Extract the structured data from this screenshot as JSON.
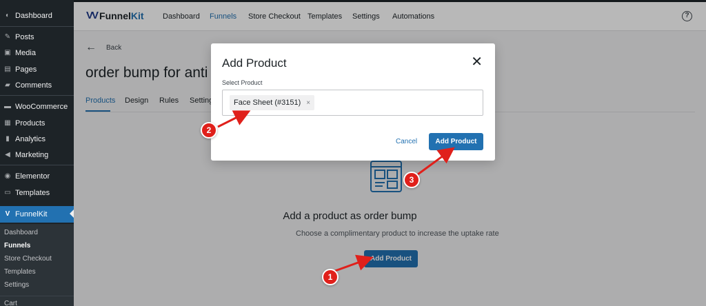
{
  "colors": {
    "accent": "#2271b1",
    "sidebar_bg": "#1d2327",
    "annotation": "#e0201b"
  },
  "sidebar": {
    "items": [
      {
        "label": "Dashboard",
        "icon": "dashboard-icon"
      },
      {
        "label": "Posts",
        "icon": "pin-icon"
      },
      {
        "label": "Media",
        "icon": "media-icon"
      },
      {
        "label": "Pages",
        "icon": "pages-icon"
      },
      {
        "label": "Comments",
        "icon": "comment-icon"
      },
      {
        "label": "WooCommerce",
        "icon": "woocommerce-icon"
      },
      {
        "label": "Products",
        "icon": "products-icon"
      },
      {
        "label": "Analytics",
        "icon": "analytics-icon"
      },
      {
        "label": "Marketing",
        "icon": "megaphone-icon"
      },
      {
        "label": "Elementor",
        "icon": "elementor-icon"
      },
      {
        "label": "Templates",
        "icon": "folder-icon"
      },
      {
        "label": "FunnelKit",
        "icon": "funnelkit-icon"
      }
    ],
    "sub_items": [
      "Dashboard",
      "Funnels",
      "Store Checkout",
      "Templates",
      "Settings"
    ],
    "after_sub": "Cart"
  },
  "topbar": {
    "logo_main": "Funnel",
    "logo_kit": "Kit",
    "nav": [
      "Dashboard",
      "Funnels",
      "Store Checkout",
      "Templates",
      "Settings",
      "Automations"
    ],
    "help": "?"
  },
  "page": {
    "back_label": "Back",
    "title": "order bump for anti a",
    "tabs": [
      "Products",
      "Design",
      "Rules",
      "Settings"
    ]
  },
  "empty_state": {
    "title": "Add a product as order bump",
    "subtitle": "Choose a complimentary product to increase the uptake rate",
    "button": "Add Product"
  },
  "modal": {
    "title": "Add Product",
    "close": "✕",
    "select_label": "Select Product",
    "selected_chip": "Face Sheet (#3151)",
    "chip_remove": "×",
    "cancel": "Cancel",
    "submit": "Add Product"
  },
  "markers": [
    "1",
    "2",
    "3"
  ]
}
